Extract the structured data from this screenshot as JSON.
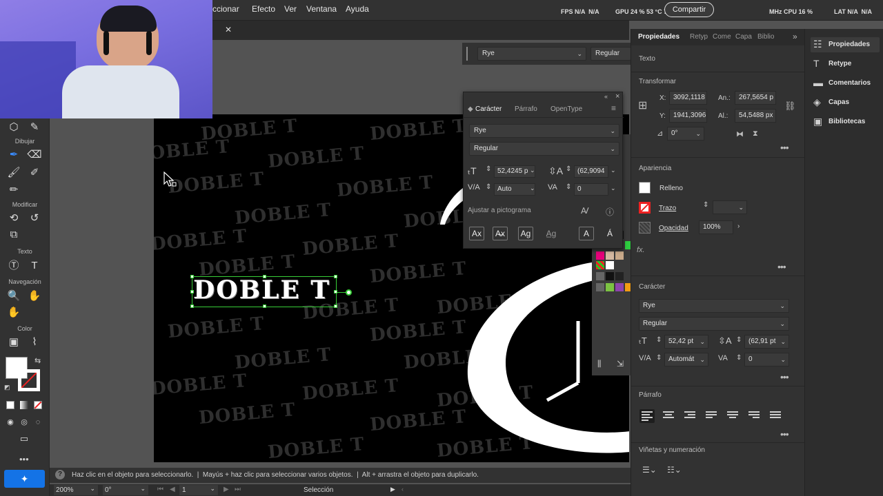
{
  "menubar": {
    "menus": [
      "ccionar",
      "Efecto",
      "Ver",
      "Ventana",
      "Ayuda"
    ],
    "fps_label": "FPS",
    "fps_values": "N/A  N/A",
    "gpu_text": "GPU 24 % 53 °C 76 %",
    "share_label": "Compartir",
    "cpu_text": "MHz  CPU 16 %",
    "lat_text": "LAT N/A  N/A"
  },
  "control_bar": {
    "font_family": "Rye",
    "font_style": "Regular"
  },
  "character_panel": {
    "tabs": [
      "Carácter",
      "Párrafo",
      "OpenType"
    ],
    "font_family": "Rye",
    "font_style": "Regular",
    "font_size": "52,4245 p",
    "leading": "(62,9094",
    "kerning": "Auto",
    "tracking": "0",
    "snap_label": "Ajustar a pictograma"
  },
  "canvas": {
    "selected_text": "DOBLE T",
    "watermark_text": "DOBLE T"
  },
  "hint_bar": {
    "text": "Haz clic en el objeto para seleccionarlo.  |  Mayús + haz clic para seleccionar varios objetos.  |  Alt + arrastra el objeto para duplicarlo."
  },
  "status_bar": {
    "zoom": "200%",
    "rotation": "0°",
    "artboard_index": "1",
    "tool_name": "Selección"
  },
  "properties": {
    "tabs": [
      "Propiedades",
      "Retyp",
      "Come",
      "Capa",
      "Biblio"
    ],
    "text_section": "Texto",
    "transform_title": "Transformar",
    "x_label": "X:",
    "x_value": "3092,1118",
    "y_label": "Y:",
    "y_value": "1941,3096",
    "w_label": "An.:",
    "w_value": "267,5654 p",
    "h_label": "Al.:",
    "h_value": "54,5488 px",
    "angle_value": "0°",
    "appearance_title": "Apariencia",
    "fill_label": "Relleno",
    "stroke_label": "Trazo",
    "opacity_label": "Opacidad",
    "opacity_value": "100%",
    "fx_label": "fx.",
    "character_title": "Carácter",
    "font_family": "Rye",
    "font_style": "Regular",
    "font_size": "52,42 pt",
    "leading": "(62,91 pt",
    "kerning": "Automát",
    "tracking": "0",
    "paragraph_title": "Párrafo",
    "bullets_title": "Viñetas y numeración"
  },
  "dock": {
    "items": [
      "Propiedades",
      "Retype",
      "Comentarios",
      "Capas",
      "Bibliotecas"
    ]
  },
  "toolbar": {
    "sections": [
      "Dibujar",
      "Modificar",
      "Texto",
      "Navegación",
      "Color"
    ]
  }
}
